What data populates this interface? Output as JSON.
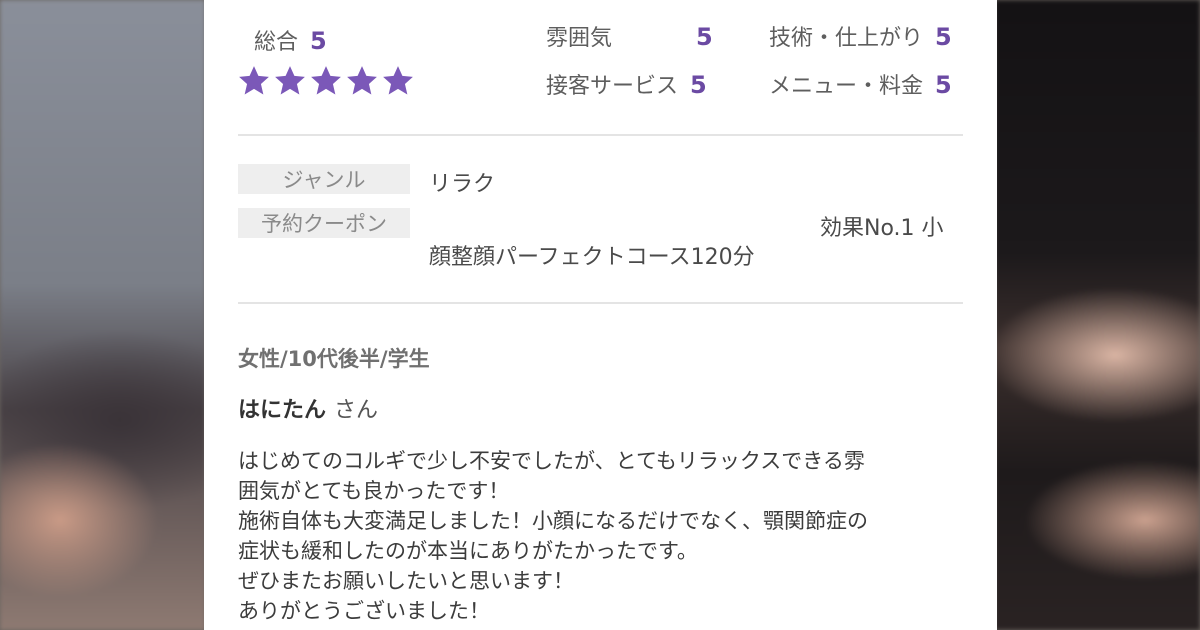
{
  "ratings": {
    "overall_label": "総合",
    "overall_value": "5",
    "star_count": 5,
    "star_color": "#7b58b8",
    "items": [
      {
        "label": "雰囲気",
        "value": "5"
      },
      {
        "label": "技術・仕上がり",
        "value": "5"
      },
      {
        "label": "接客サービス",
        "value": "5"
      },
      {
        "label": "メニュー・料金",
        "value": "5"
      }
    ]
  },
  "details": {
    "genre_label": "ジャンル",
    "genre_value": "リラク",
    "coupon_label": "予約クーポン",
    "coupon_line1": "効果No.1 小",
    "coupon_line2": "顔整顔パーフェクトコース120分"
  },
  "review": {
    "reviewer_meta": "女性/10代後半/学生",
    "reviewer_name": "はにたん",
    "reviewer_suffix": "さん",
    "lines": [
      "はじめてのコルギで少し不安でしたが、とてもリラックスできる雰",
      "囲気がとても良かったです！",
      "施術自体も大変満足しました！小顔になるだけでなく、顎関節症の",
      "症状も緩和したのが本当にありがたかったです。",
      "ぜひまたお願いしたいと思います！",
      "ありがとうございました！"
    ]
  }
}
